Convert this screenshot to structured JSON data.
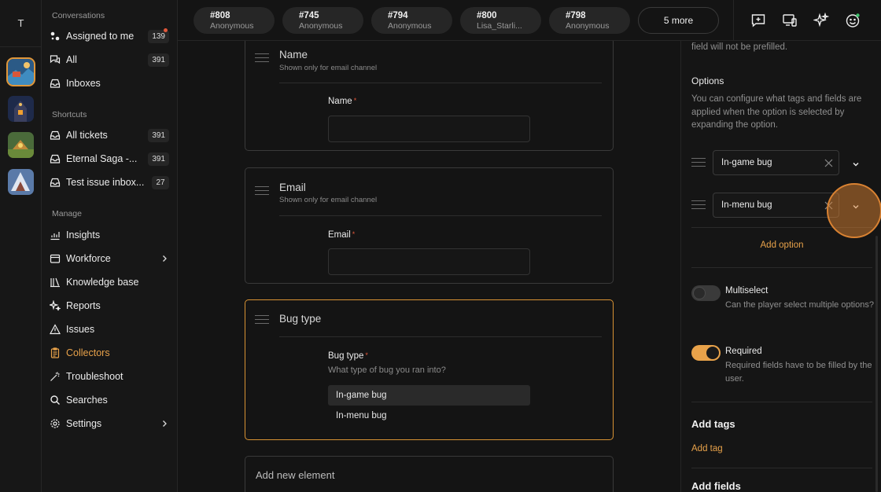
{
  "workspace_initial": "T",
  "sidebar": {
    "conversations_title": "Conversations",
    "assigned_label": "Assigned to me",
    "assigned_count": "139",
    "all_label": "All",
    "all_count": "391",
    "inboxes_label": "Inboxes",
    "shortcuts_title": "Shortcuts",
    "all_tickets_label": "All tickets",
    "all_tickets_count": "391",
    "eternal_label": "Eternal Saga -...",
    "eternal_count": "391",
    "test_label": "Test issue inbox...",
    "test_count": "27",
    "manage_title": "Manage",
    "insights_label": "Insights",
    "workforce_label": "Workforce",
    "knowledge_label": "Knowledge base",
    "reports_label": "Reports",
    "issues_label": "Issues",
    "collectors_label": "Collectors",
    "troubleshoot_label": "Troubleshoot",
    "searches_label": "Searches",
    "settings_label": "Settings"
  },
  "tabs": [
    {
      "id": "#808",
      "sub": "Anonymous"
    },
    {
      "id": "#745",
      "sub": "Anonymous"
    },
    {
      "id": "#794",
      "sub": "Anonymous"
    },
    {
      "id": "#800",
      "sub": "Lisa_Starli..."
    },
    {
      "id": "#798",
      "sub": "Anonymous"
    }
  ],
  "more_label": "5 more",
  "cards": {
    "name_title": "Name",
    "name_sub": "Shown only for email channel",
    "name_label": "Name",
    "email_title": "Email",
    "email_sub": "Shown only for email channel",
    "email_label": "Email",
    "bug_title": "Bug type",
    "bug_label": "Bug type",
    "bug_help": "What type of bug you ran into?",
    "bug_options": [
      "In-game bug",
      "In-menu bug"
    ],
    "required_mark": "*"
  },
  "add_element_label": "Add new element",
  "panel": {
    "prefill_note": "field will not be prefilled.",
    "options_title": "Options",
    "options_desc": "You can configure what tags and fields are applied when the option is selected by expanding the option.",
    "option_1": "In-game bug",
    "option_2": "In-menu bug",
    "add_option": "Add option",
    "multiselect_label": "Multiselect",
    "multiselect_desc": "Can the player select multiple options?",
    "required_label": "Required",
    "required_desc": "Required fields have to be filled by the user.",
    "add_tags_title": "Add tags",
    "add_tag_link": "Add tag",
    "add_fields_title": "Add fields",
    "multiselect_on": false,
    "required_on": true
  },
  "colors": {
    "accent": "#e8a24a",
    "background": "#141414",
    "alert": "#e0573a"
  }
}
